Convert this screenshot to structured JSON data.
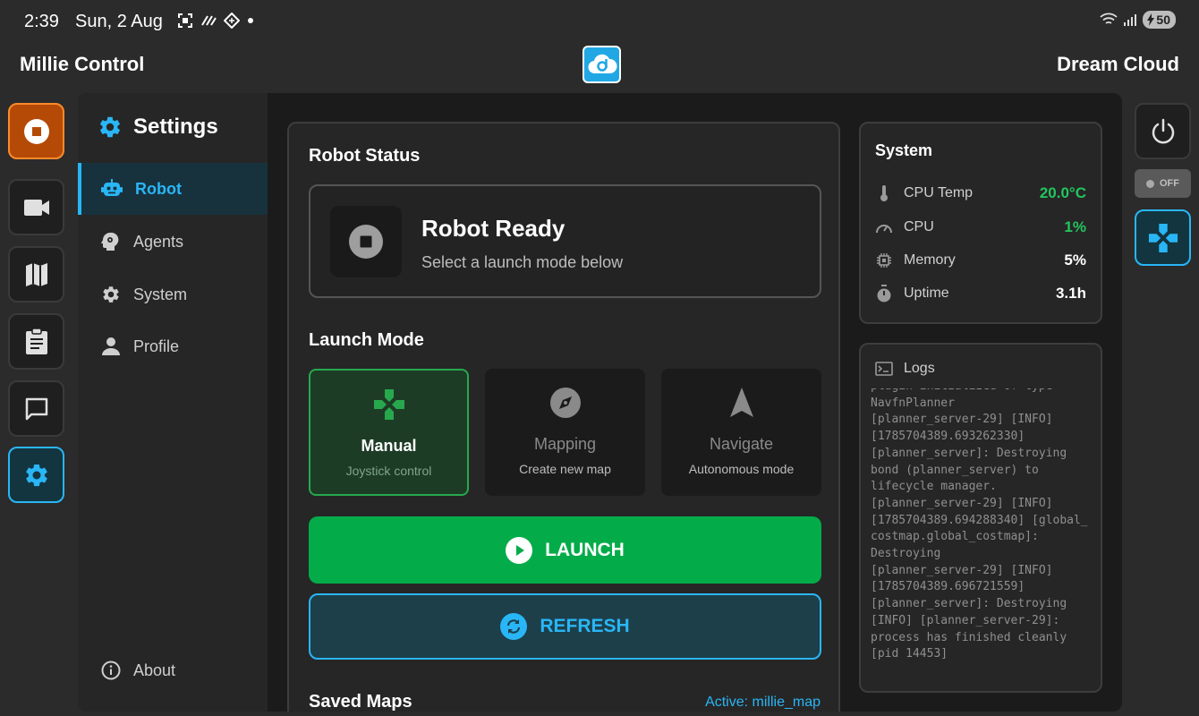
{
  "status_bar": {
    "time": "2:39",
    "date": "Sun, 2 Aug",
    "battery": "50"
  },
  "header": {
    "title": "Millie Control",
    "right_title": "Dream Cloud",
    "logo": "cloud-logo-icon"
  },
  "left_rail": [
    {
      "icon": "stop-icon",
      "state": "stop"
    },
    {
      "icon": "camera-icon"
    },
    {
      "icon": "map-icon"
    },
    {
      "icon": "clipboard-icon"
    },
    {
      "icon": "chat-icon"
    },
    {
      "icon": "gear-icon",
      "state": "active"
    }
  ],
  "settings": {
    "title": "Settings",
    "nav": [
      {
        "label": "Robot",
        "icon": "robot-icon",
        "active": true
      },
      {
        "label": "Agents",
        "icon": "head-gear-icon"
      },
      {
        "label": "System",
        "icon": "gear-icon"
      },
      {
        "label": "Profile",
        "icon": "person-icon"
      }
    ],
    "about": "About"
  },
  "robot_status": {
    "section_title": "Robot Status",
    "title": "Robot Ready",
    "subtitle": "Select a launch mode below"
  },
  "launch_mode": {
    "section_title": "Launch Mode",
    "modes": [
      {
        "name": "Manual",
        "desc": "Joystick control",
        "icon": "gamepad-icon",
        "selected": true
      },
      {
        "name": "Mapping",
        "desc": "Create new map",
        "icon": "compass-icon"
      },
      {
        "name": "Navigate",
        "desc": "Autonomous mode",
        "icon": "navigation-arrow-icon"
      }
    ],
    "launch_label": "LAUNCH",
    "refresh_label": "REFRESH"
  },
  "saved_maps": {
    "section_title": "Saved Maps",
    "active_label": "Active: millie_map"
  },
  "system": {
    "title": "System",
    "rows": [
      {
        "label": "CPU Temp",
        "value": "20.0°C",
        "icon": "thermometer-icon",
        "color": "#22c55e"
      },
      {
        "label": "CPU",
        "value": "1%",
        "icon": "speedometer-icon",
        "color": "#22c55e"
      },
      {
        "label": "Memory",
        "value": "5%",
        "icon": "chip-icon",
        "color": "#ffffff"
      },
      {
        "label": "Uptime",
        "value": "3.1h",
        "icon": "timer-icon",
        "color": "#ffffff"
      }
    ]
  },
  "logs": {
    "title": "Logs",
    "text": "plugin initialized of type\nNavfnPlanner\n[planner_server-29] [INFO]\n[1785704389.693262330]\n[planner_server]: Destroying\nbond (planner_server) to\nlifecycle manager.\n[planner_server-29] [INFO]\n[1785704389.694288340] [global_costmap.global_costmap]:\nDestroying\n[planner_server-29] [INFO]\n[1785704389.696721559]\n[planner_server]: Destroying\n[INFO] [planner_server-29]:\nprocess has finished cleanly\n[pid 14453]"
  },
  "right_rail": {
    "toggle_label": "OFF",
    "power_icon": "power-icon",
    "joystick_icon": "gamepad-icon"
  },
  "colors": {
    "accent": "#29b6f6",
    "success": "#03ac49",
    "stop": "#b44a06",
    "panel": "#1b1b1b"
  }
}
